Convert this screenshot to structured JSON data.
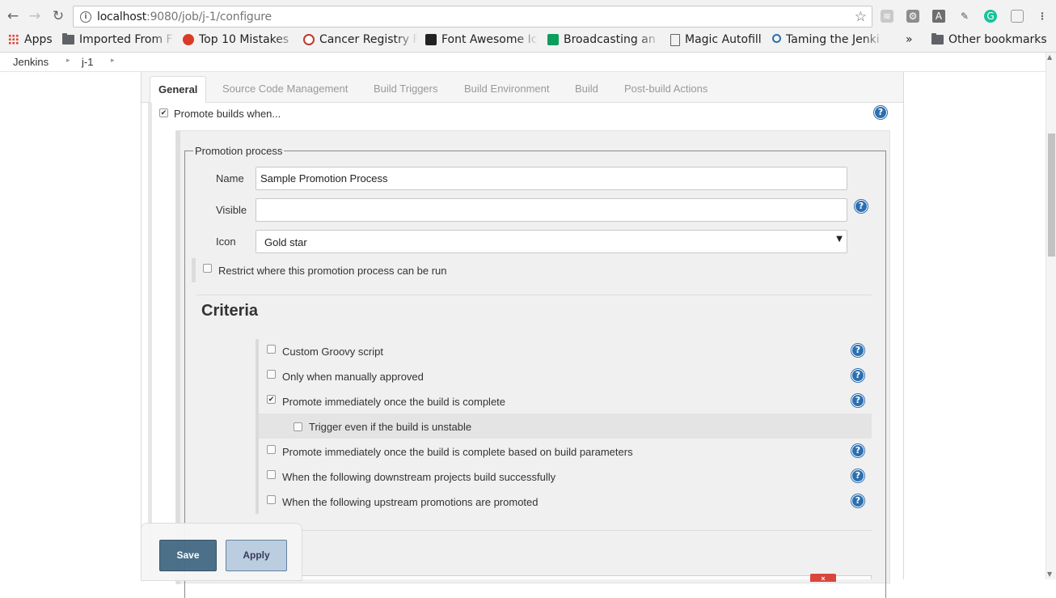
{
  "browser": {
    "url_host": "localhost",
    "url_rest": ":9080/job/j-1/configure",
    "bookmarks": [
      {
        "label": "Apps",
        "icon": "apps-grid-icon"
      },
      {
        "label": "Imported From F",
        "icon": "folder-icon"
      },
      {
        "label": "Top 10 Mistakes",
        "icon": "bookmark-icon"
      },
      {
        "label": "Cancer Registry F",
        "icon": "bookmark-icon"
      },
      {
        "label": "Font Awesome Ic",
        "icon": "flag-icon"
      },
      {
        "label": "Broadcasting an",
        "icon": "bookmark-icon"
      },
      {
        "label": "Magic Autofill",
        "icon": ""
      },
      {
        "label": "Taming the Jenki",
        "icon": "bookmark-icon"
      }
    ],
    "overflow": "»",
    "other_bookmarks": "Other bookmarks"
  },
  "breadcrumb": {
    "items": [
      "Jenkins",
      "j-1"
    ]
  },
  "tabs": [
    "General",
    "Source Code Management",
    "Build Triggers",
    "Build Environment",
    "Build",
    "Post-build Actions"
  ],
  "general": {
    "promote_label": "Promote builds when...",
    "promote_checked": true
  },
  "promotion": {
    "legend": "Promotion process",
    "name_label": "Name",
    "name_value": "Sample Promotion Process",
    "visible_label": "Visible",
    "visible_value": "",
    "icon_label": "Icon",
    "icon_value": "Gold star",
    "restrict_label": "Restrict where this promotion process can be run",
    "criteria_title": "Criteria",
    "criteria": [
      {
        "label": "Custom Groovy script",
        "checked": false
      },
      {
        "label": "Only when manually approved",
        "checked": false
      },
      {
        "label": "Promote immediately once the build is complete",
        "checked": true
      },
      {
        "label": "Trigger even if the build is unstable",
        "checked": false,
        "sub": true
      },
      {
        "label": "Promote immediately once the build is complete based on build parameters",
        "checked": false
      },
      {
        "label": "When the following downstream projects build successfully",
        "checked": false
      },
      {
        "label": "When the following upstream promotions are promoted",
        "checked": false
      }
    ]
  },
  "buttons": {
    "save": "Save",
    "apply": "Apply"
  },
  "colors": {
    "help_blue": "#2c6fb1",
    "save_bg": "#466b85",
    "apply_bg": "#b9cde0",
    "delete_red": "#d9463c"
  }
}
